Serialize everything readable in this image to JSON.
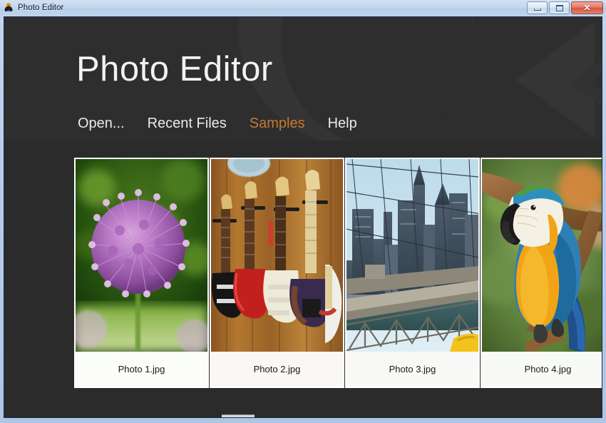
{
  "window": {
    "title": "Photo Editor",
    "icon": "app-butterfly-icon",
    "controls": {
      "minimize": "–",
      "maximize": "□",
      "close": "✕"
    }
  },
  "header": {
    "page_title": "Photo Editor",
    "accent_color": "#c87832",
    "background_color": "#2e2e2e"
  },
  "nav": {
    "items": [
      {
        "label": "Open...",
        "active": false
      },
      {
        "label": "Recent Files",
        "active": false
      },
      {
        "label": "Samples",
        "active": true
      },
      {
        "label": "Help",
        "active": false
      }
    ]
  },
  "gallery": {
    "background_color": "#2b2b2b",
    "tiles": [
      {
        "caption": "Photo 1.jpg",
        "subject": "purple-allium-flower"
      },
      {
        "caption": "Photo 2.jpg",
        "subject": "electric-guitars-on-wall"
      },
      {
        "caption": "Photo 3.jpg",
        "subject": "brooklyn-bridge-skyline"
      },
      {
        "caption": "Photo 4.jpg",
        "subject": "blue-and-gold-macaw"
      }
    ]
  }
}
